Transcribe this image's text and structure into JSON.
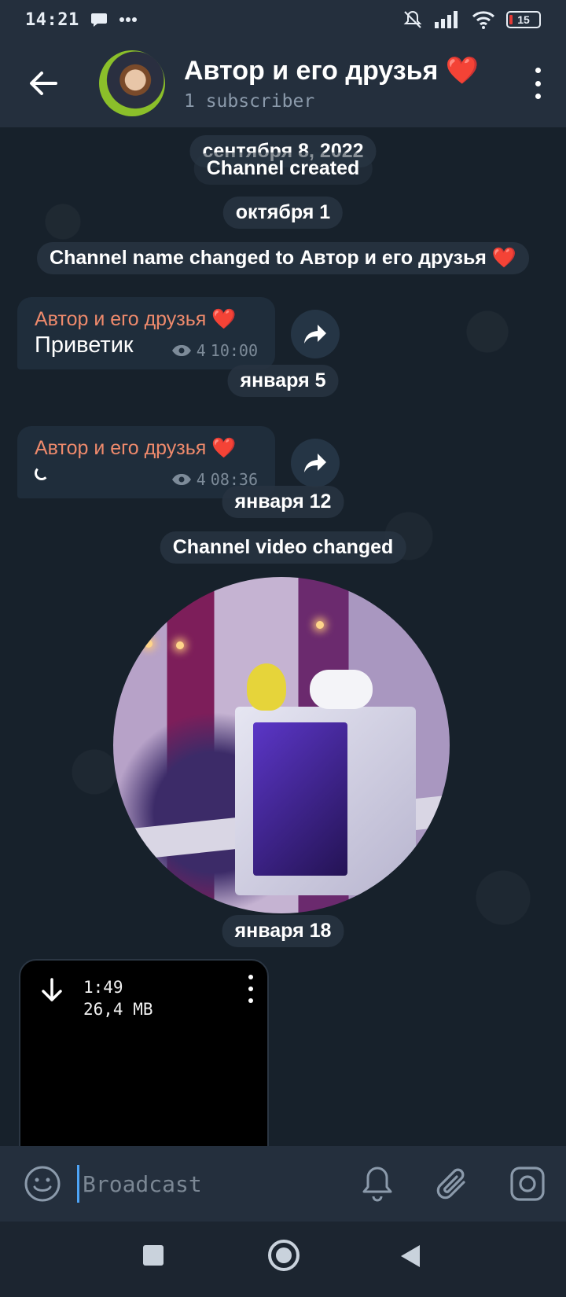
{
  "status_bar": {
    "time": "14:21",
    "battery": "15",
    "icons": [
      "chat-bubble-icon",
      "more-dots-icon",
      "mute-icon",
      "signal-icon",
      "wifi-icon",
      "battery-icon"
    ]
  },
  "header": {
    "title": "Автор и его друзья ❤️",
    "subtitle": "1 subscriber"
  },
  "chat": {
    "date_1": "сентября 8, 2022",
    "service_1": "Channel created",
    "date_2": "октября 1",
    "service_2": "Channel name changed to Автор и его друзья ❤️",
    "message_1": {
      "sender": "Автор и его друзья ❤️",
      "text": "Приветик",
      "views": "4",
      "time": "10:00"
    },
    "date_3": "января 5",
    "message_2": {
      "sender": "Автор и его друзья ❤️",
      "views": "4",
      "time": "08:36"
    },
    "date_4": "января 12",
    "service_3": "Channel video changed",
    "date_5": "января 18",
    "file": {
      "duration": "1:49",
      "size": "26,4 MB"
    }
  },
  "input": {
    "placeholder": "Broadcast"
  },
  "colors": {
    "accent": "#4ea4f6",
    "sender": "#ef8a6c",
    "header_bg": "#242f3d",
    "chat_bg": "#17212b"
  }
}
